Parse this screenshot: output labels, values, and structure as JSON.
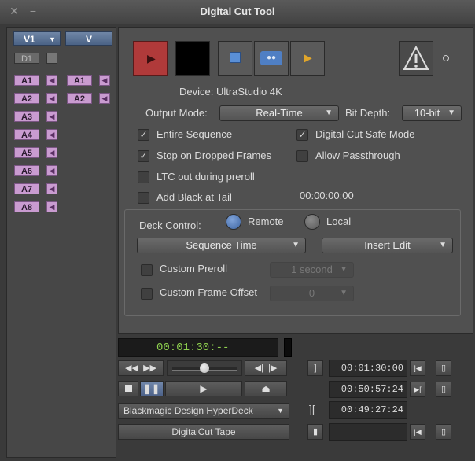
{
  "window": {
    "title": "Digital Cut Tool"
  },
  "tracks": {
    "video_source": "V1",
    "video_record": "V",
    "data_track": "D1",
    "audio_left": [
      "A1",
      "A2",
      "A3",
      "A4",
      "A5",
      "A6",
      "A7",
      "A8"
    ],
    "audio_right": [
      "A1",
      "A2"
    ]
  },
  "device": {
    "label": "Device: UltraStudio 4K"
  },
  "output_mode": {
    "label": "Output Mode:",
    "value": "Real-Time"
  },
  "bit_depth": {
    "label": "Bit Depth:",
    "value": "10-bit"
  },
  "options": {
    "entire_sequence": {
      "label": "Entire Sequence",
      "checked": true
    },
    "digital_cut_safe_mode": {
      "label": "Digital Cut Safe Mode",
      "checked": true
    },
    "stop_on_dropped_frames": {
      "label": "Stop on Dropped Frames",
      "checked": true
    },
    "allow_passthrough": {
      "label": "Allow Passthrough",
      "checked": false
    },
    "ltc_out": {
      "label": "LTC out during preroll",
      "checked": false
    },
    "add_black": {
      "label": "Add Black at Tail",
      "checked": false
    },
    "black_timecode": "00:00:00:00"
  },
  "deck_control": {
    "label": "Deck Control:",
    "remote": "Remote",
    "local": "Local",
    "selected": "Remote",
    "time_source": "Sequence Time",
    "edit_mode": "Insert Edit",
    "custom_preroll": {
      "label": "Custom Preroll",
      "value": "1 second",
      "checked": false
    },
    "custom_frame_offset": {
      "label": "Custom Frame Offset",
      "value": "0",
      "checked": false
    }
  },
  "deck": {
    "timecode": "00:01:30:--",
    "deck_name": "Blackmagic Design HyperDeck",
    "tape_name": "DigitalCut Tape",
    "mark_in": "00:01:30:00",
    "mark_out": "00:50:57:24",
    "duration": "00:49:27:24",
    "shuttle_position": 0.5
  },
  "colors": {
    "record_red": "#b03a3a",
    "timecode_green": "#8fd14f",
    "track_purple": "#c99bd0",
    "selector_blue": "#5a7396"
  }
}
